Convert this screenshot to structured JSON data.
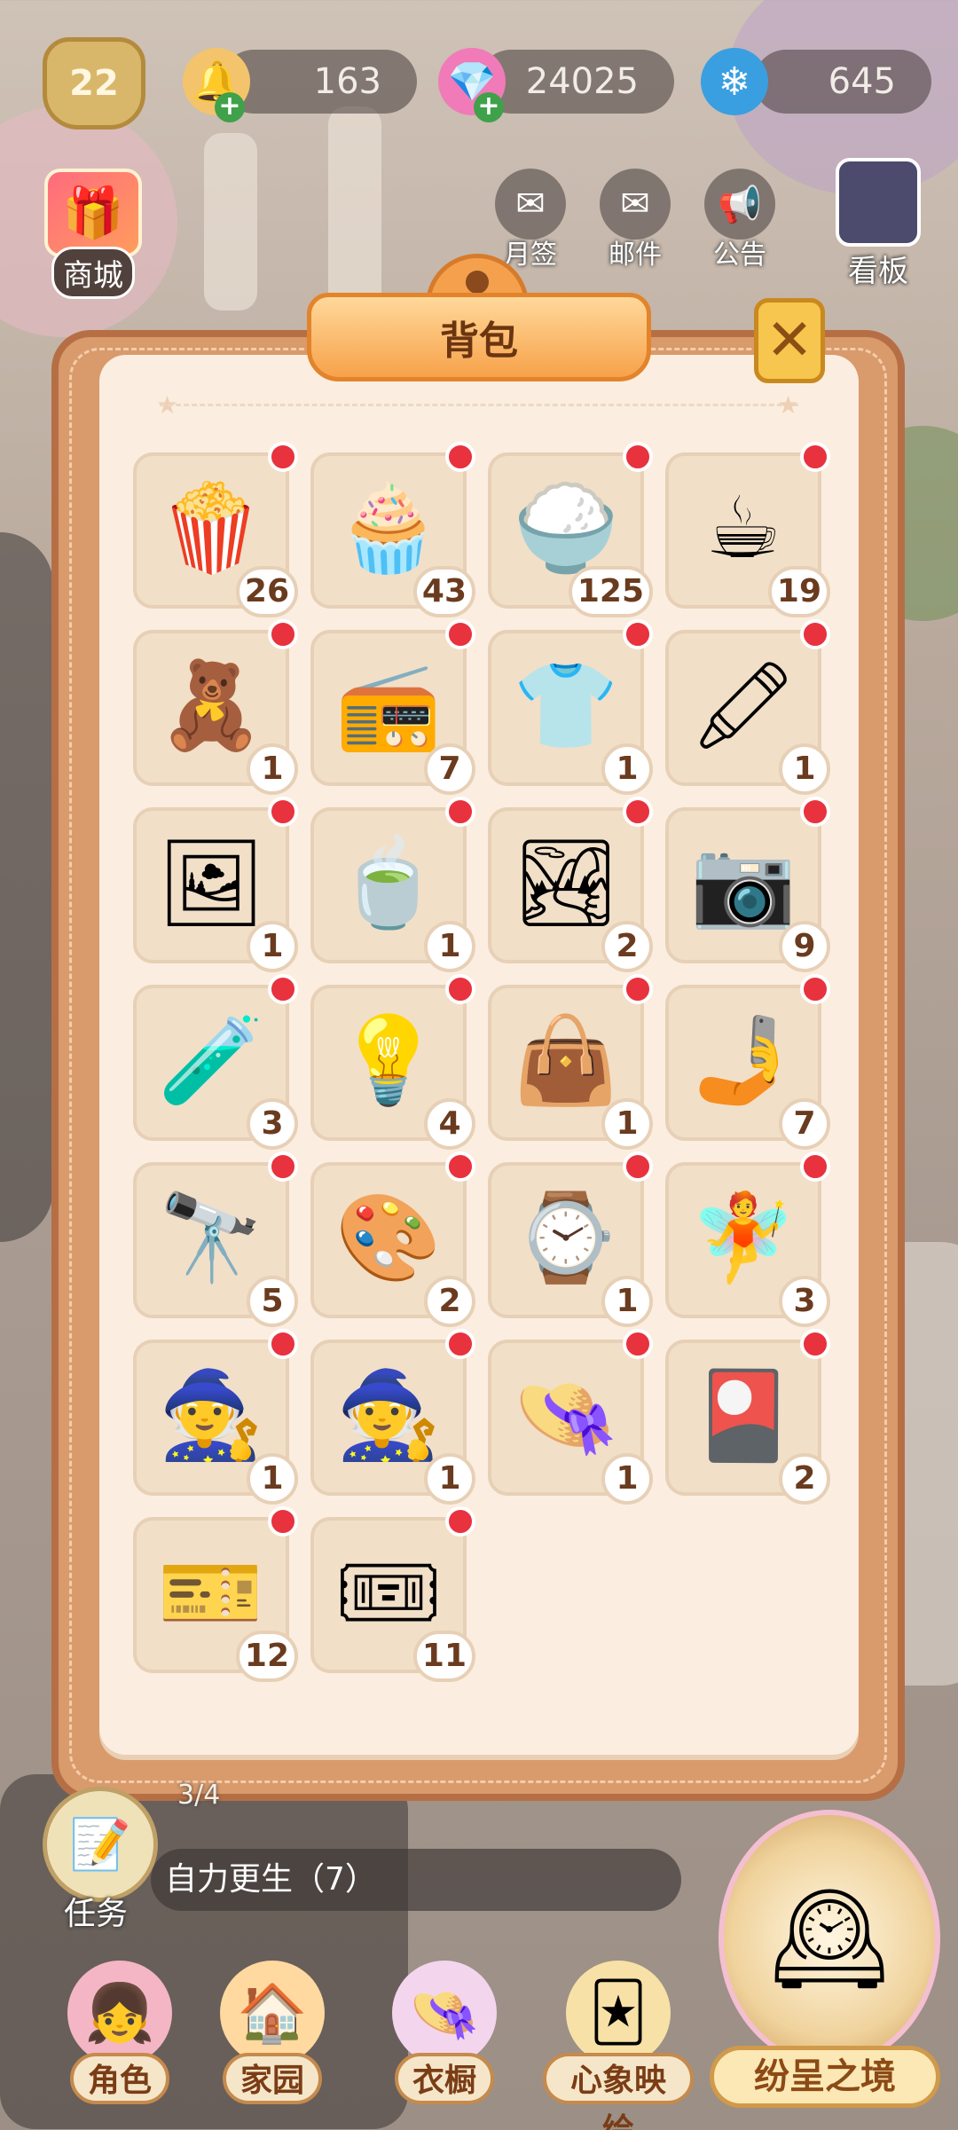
{
  "player": {
    "level": "22"
  },
  "resources": [
    {
      "name": "bell-coin",
      "value": "163",
      "icon": "🔔"
    },
    {
      "name": "pink-gem",
      "value": "24025",
      "icon": "💎"
    },
    {
      "name": "snowflake",
      "value": "645",
      "icon": "❄"
    }
  ],
  "shortcuts": {
    "shop": "商城",
    "monthly_sign": "月签",
    "mail": "邮件",
    "notice": "公告",
    "board": "看板"
  },
  "backpack": {
    "title": "背包",
    "close_icon": "✕",
    "items": [
      {
        "icon": "🍿",
        "count": "26"
      },
      {
        "icon": "🧁",
        "count": "43"
      },
      {
        "icon": "🍚",
        "count": "125"
      },
      {
        "icon": "☕",
        "count": "19"
      },
      {
        "icon": "🧸",
        "count": "1"
      },
      {
        "icon": "📻",
        "count": "7"
      },
      {
        "icon": "👕",
        "count": "1"
      },
      {
        "icon": "🖍",
        "count": "1"
      },
      {
        "icon": "🖼",
        "count": "1"
      },
      {
        "icon": "🍵",
        "count": "1"
      },
      {
        "icon": "🏞",
        "count": "2"
      },
      {
        "icon": "📷",
        "count": "9"
      },
      {
        "icon": "🧪",
        "count": "3"
      },
      {
        "icon": "💡",
        "count": "4"
      },
      {
        "icon": "👜",
        "count": "1"
      },
      {
        "icon": "🤳",
        "count": "7"
      },
      {
        "icon": "🔭",
        "count": "5"
      },
      {
        "icon": "🎨",
        "count": "2"
      },
      {
        "icon": "⌚",
        "count": "1"
      },
      {
        "icon": "🧚",
        "count": "3"
      },
      {
        "icon": "🧙",
        "count": "1"
      },
      {
        "icon": "🧙",
        "count": "1"
      },
      {
        "icon": "👒",
        "count": "1"
      },
      {
        "icon": "🎴",
        "count": "2"
      },
      {
        "icon": "🎫",
        "count": "12"
      },
      {
        "icon": "🎟",
        "count": "11"
      }
    ]
  },
  "task": {
    "progress": "3/4",
    "name": "自力更生（7）",
    "label": "任务"
  },
  "nav": [
    {
      "label": "角色",
      "icon": "👧"
    },
    {
      "label": "家园",
      "icon": "🏠"
    },
    {
      "label": "衣橱",
      "icon": "👒"
    },
    {
      "label": "心象映绘",
      "icon": "🃏"
    }
  ],
  "portal": {
    "label": "纷呈之境",
    "icon": "🕰"
  }
}
